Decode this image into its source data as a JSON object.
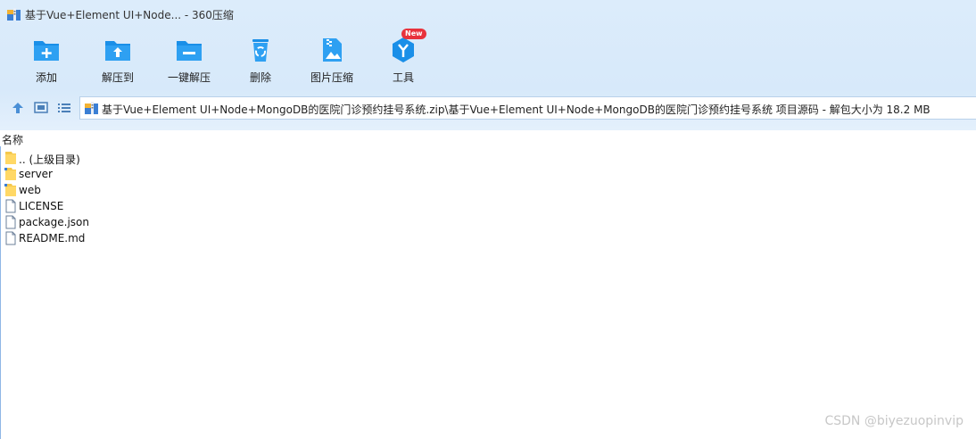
{
  "window": {
    "title": "基于Vue+Element UI+Node... - 360压缩"
  },
  "toolbar": {
    "items": [
      {
        "label": "添加",
        "icon": "add-folder-icon"
      },
      {
        "label": "解压到",
        "icon": "extract-to-icon"
      },
      {
        "label": "一键解压",
        "icon": "one-click-extract-icon"
      },
      {
        "label": "删除",
        "icon": "recycle-bin-icon"
      },
      {
        "label": "图片压缩",
        "icon": "image-compress-icon"
      },
      {
        "label": "工具",
        "icon": "tools-icon",
        "badge": "New"
      }
    ]
  },
  "address": {
    "path": "基于Vue+Element UI+Node+MongoDB的医院门诊预约挂号系统.zip\\基于Vue+Element UI+Node+MongoDB的医院门诊预约挂号系统 项目源码 - 解包大小为 18.2 MB"
  },
  "columns": {
    "name": "名称"
  },
  "files": [
    {
      "name": ".. (上级目录)",
      "type": "folder"
    },
    {
      "name": "server",
      "type": "folder"
    },
    {
      "name": "web",
      "type": "folder"
    },
    {
      "name": "LICENSE",
      "type": "file"
    },
    {
      "name": "package.json",
      "type": "file"
    },
    {
      "name": "README.md",
      "type": "file"
    }
  ],
  "watermark": "CSDN @biyezuopinvip",
  "colors": {
    "accent": "#1a8fe8",
    "chrome_bg": "#d7e9fa",
    "folder": "#f5c84c"
  }
}
